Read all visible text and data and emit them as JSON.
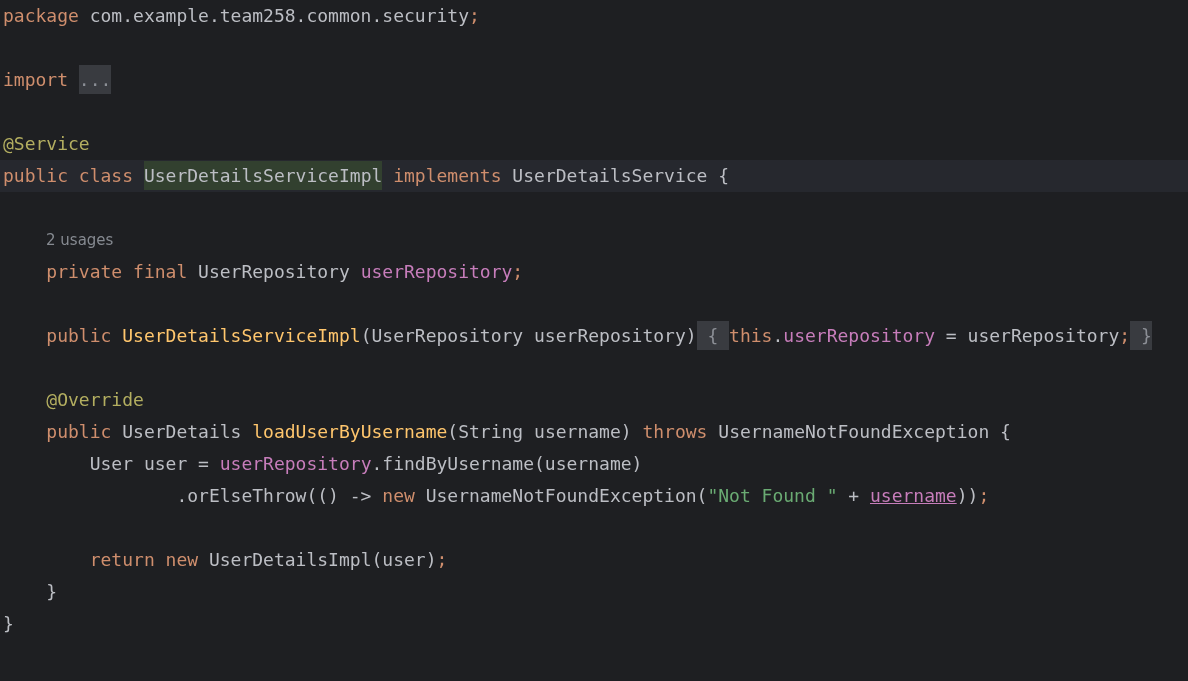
{
  "lines": [
    {
      "kind": "code",
      "current": false,
      "tokens": [
        {
          "kind": "keyword",
          "text": "package"
        },
        {
          "kind": "plain",
          "text": " com.example.team258.common.security"
        },
        {
          "kind": "keyword",
          "text": ";"
        }
      ]
    },
    {
      "kind": "blank",
      "current": false
    },
    {
      "kind": "code",
      "current": false,
      "tokens": [
        {
          "kind": "keyword",
          "text": "import "
        },
        {
          "kind": "folded",
          "text": "..."
        }
      ]
    },
    {
      "kind": "blank",
      "current": false
    },
    {
      "kind": "code",
      "current": false,
      "tokens": [
        {
          "kind": "annotation",
          "text": "@Service"
        }
      ]
    },
    {
      "kind": "code",
      "current": true,
      "tokens": [
        {
          "kind": "keyword",
          "text": "public class "
        },
        {
          "kind": "match",
          "text": "UserDetailsServiceImpl"
        },
        {
          "kind": "keyword",
          "text": " implements"
        },
        {
          "kind": "plain",
          "text": " UserDetailsService {"
        }
      ]
    },
    {
      "kind": "blank",
      "current": false
    },
    {
      "kind": "hint",
      "current": false,
      "tokens": [
        {
          "kind": "hint",
          "text": "2 usages"
        }
      ]
    },
    {
      "kind": "code",
      "current": false,
      "tokens": [
        {
          "kind": "keyword",
          "text": "    private final"
        },
        {
          "kind": "plain",
          "text": " UserRepository "
        },
        {
          "kind": "field",
          "text": "userRepository"
        },
        {
          "kind": "keyword",
          "text": ";"
        }
      ]
    },
    {
      "kind": "blank",
      "current": false
    },
    {
      "kind": "code",
      "current": false,
      "tokens": [
        {
          "kind": "keyword",
          "text": "    public "
        },
        {
          "kind": "declaration",
          "text": "UserDetailsServiceImpl"
        },
        {
          "kind": "plain",
          "text": "(UserRepository userRepository)"
        },
        {
          "kind": "folded",
          "text": " { "
        },
        {
          "kind": "keyword",
          "text": "this"
        },
        {
          "kind": "plain",
          "text": "."
        },
        {
          "kind": "field",
          "text": "userRepository"
        },
        {
          "kind": "plain",
          "text": " = userRepository"
        },
        {
          "kind": "keyword",
          "text": ";"
        },
        {
          "kind": "folded",
          "text": " }"
        }
      ]
    },
    {
      "kind": "blank",
      "current": false
    },
    {
      "kind": "code",
      "current": false,
      "tokens": [
        {
          "kind": "annotation",
          "text": "    @Override"
        }
      ]
    },
    {
      "kind": "code",
      "current": false,
      "tokens": [
        {
          "kind": "keyword",
          "text": "    public"
        },
        {
          "kind": "plain",
          "text": " UserDetails "
        },
        {
          "kind": "declaration",
          "text": "loadUserByUsername"
        },
        {
          "kind": "plain",
          "text": "(String username) "
        },
        {
          "kind": "keyword",
          "text": "throws"
        },
        {
          "kind": "plain",
          "text": " UsernameNotFoundException {"
        }
      ]
    },
    {
      "kind": "code",
      "current": false,
      "tokens": [
        {
          "kind": "plain",
          "text": "        User user = "
        },
        {
          "kind": "field",
          "text": "userRepository"
        },
        {
          "kind": "plain",
          "text": ".findByUsername(username)"
        }
      ]
    },
    {
      "kind": "code",
      "current": false,
      "tokens": [
        {
          "kind": "plain",
          "text": "                .orElseThrow(() -> "
        },
        {
          "kind": "keyword",
          "text": "new"
        },
        {
          "kind": "plain",
          "text": " UsernameNotFoundException("
        },
        {
          "kind": "string",
          "text": "\"Not Found \""
        },
        {
          "kind": "plain",
          "text": " + "
        },
        {
          "kind": "captured",
          "text": "username"
        },
        {
          "kind": "plain",
          "text": "))"
        },
        {
          "kind": "keyword",
          "text": ";"
        }
      ]
    },
    {
      "kind": "blank",
      "current": false
    },
    {
      "kind": "code",
      "current": false,
      "tokens": [
        {
          "kind": "keyword",
          "text": "        return new"
        },
        {
          "kind": "plain",
          "text": " UserDetailsImpl(user)"
        },
        {
          "kind": "keyword",
          "text": ";"
        }
      ]
    },
    {
      "kind": "code",
      "current": false,
      "tokens": [
        {
          "kind": "plain",
          "text": "    }"
        }
      ]
    },
    {
      "kind": "code",
      "current": false,
      "tokens": [
        {
          "kind": "plain",
          "text": "}"
        }
      ]
    }
  ]
}
